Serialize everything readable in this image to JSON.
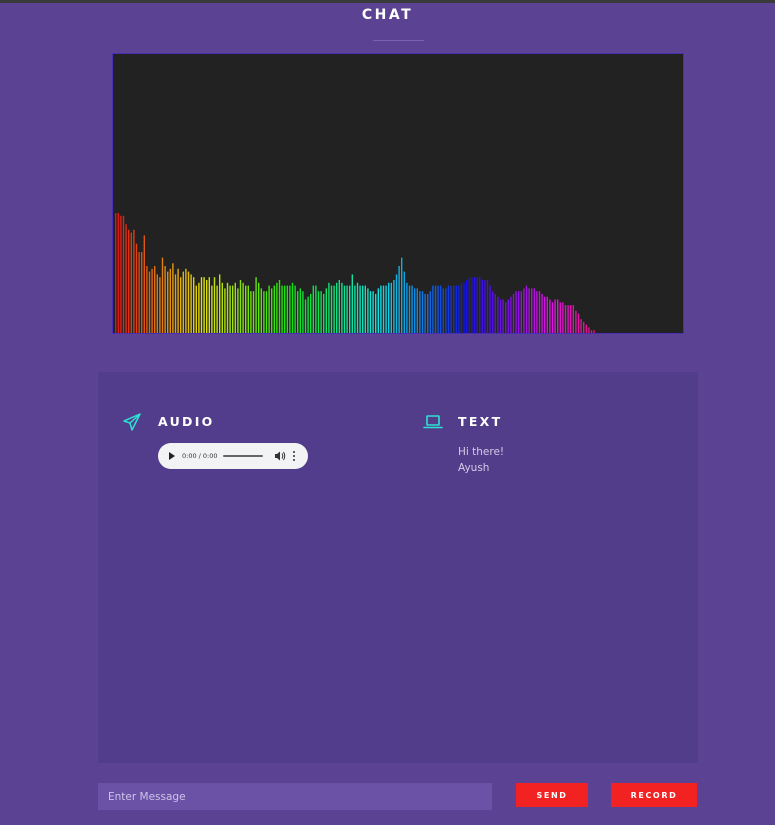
{
  "header": {
    "title": "CHAT"
  },
  "visualizer": {
    "background": "#222222",
    "border": "#4a2fb5",
    "levels": [
      0.43,
      0.43,
      0.42,
      0.42,
      0.39,
      0.37,
      0.36,
      0.37,
      0.32,
      0.29,
      0.29,
      0.35,
      0.24,
      0.22,
      0.23,
      0.24,
      0.21,
      0.2,
      0.27,
      0.24,
      0.22,
      0.23,
      0.25,
      0.21,
      0.23,
      0.2,
      0.22,
      0.23,
      0.22,
      0.21,
      0.2,
      0.17,
      0.18,
      0.2,
      0.2,
      0.19,
      0.2,
      0.17,
      0.2,
      0.17,
      0.21,
      0.18,
      0.16,
      0.18,
      0.17,
      0.17,
      0.18,
      0.16,
      0.19,
      0.18,
      0.17,
      0.17,
      0.15,
      0.15,
      0.2,
      0.18,
      0.16,
      0.15,
      0.15,
      0.17,
      0.16,
      0.17,
      0.18,
      0.19,
      0.17,
      0.17,
      0.17,
      0.17,
      0.18,
      0.17,
      0.15,
      0.16,
      0.15,
      0.12,
      0.13,
      0.14,
      0.17,
      0.17,
      0.15,
      0.15,
      0.14,
      0.16,
      0.18,
      0.17,
      0.17,
      0.18,
      0.19,
      0.18,
      0.17,
      0.17,
      0.17,
      0.21,
      0.17,
      0.18,
      0.17,
      0.17,
      0.17,
      0.16,
      0.15,
      0.15,
      0.14,
      0.16,
      0.17,
      0.17,
      0.17,
      0.18,
      0.18,
      0.19,
      0.21,
      0.24,
      0.27,
      0.22,
      0.18,
      0.17,
      0.17,
      0.16,
      0.16,
      0.15,
      0.15,
      0.14,
      0.14,
      0.15,
      0.17,
      0.17,
      0.17,
      0.17,
      0.16,
      0.16,
      0.17,
      0.17,
      0.17,
      0.17,
      0.17,
      0.18,
      0.18,
      0.19,
      0.2,
      0.2,
      0.2,
      0.2,
      0.2,
      0.19,
      0.19,
      0.19,
      0.17,
      0.15,
      0.14,
      0.13,
      0.12,
      0.12,
      0.11,
      0.12,
      0.13,
      0.14,
      0.15,
      0.15,
      0.15,
      0.16,
      0.17,
      0.16,
      0.16,
      0.16,
      0.15,
      0.15,
      0.14,
      0.13,
      0.13,
      0.12,
      0.11,
      0.12,
      0.12,
      0.11,
      0.11,
      0.1,
      0.1,
      0.1,
      0.1,
      0.08,
      0.07,
      0.05,
      0.04,
      0.03,
      0.02,
      0.01,
      0.01
    ]
  },
  "audio_panel": {
    "title": "AUDIO",
    "player": {
      "time": "0:00 / 0:00"
    }
  },
  "text_panel": {
    "title": "TEXT",
    "messages": [
      "Hi there!",
      "Ayush"
    ]
  },
  "composer": {
    "placeholder": "Enter Message",
    "send_label": "SEND",
    "record_label": "RECORD"
  },
  "colors": {
    "background": "#5b4293",
    "panel": "#513d8b",
    "accent_icon": "#2fe0d4",
    "button": "#f22222",
    "input": "#6b52a6"
  }
}
